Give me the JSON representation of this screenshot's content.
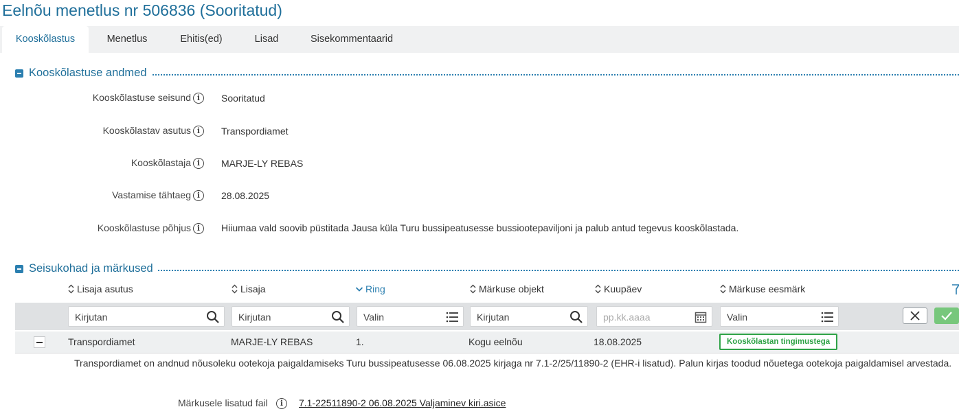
{
  "page_title": "Eelnõu menetlus nr 506836 (Sooritatud)",
  "tabs": [
    {
      "label": "Kooskõlastus",
      "active": true
    },
    {
      "label": "Menetlus",
      "active": false
    },
    {
      "label": "Ehitis(ed)",
      "active": false
    },
    {
      "label": "Lisad",
      "active": false
    },
    {
      "label": "Sisekommentaarid",
      "active": false
    }
  ],
  "section_details": {
    "title": "Kooskõlastuse andmed",
    "fields": [
      {
        "label": "Kooskõlastuse seisund",
        "value": "Sooritatud"
      },
      {
        "label": "Kooskõlastav asutus",
        "value": "Transpordiamet"
      },
      {
        "label": "Kooskõlastaja",
        "value": "MARJE-LY REBAS"
      },
      {
        "label": "Vastamise tähtaeg",
        "value": "28.08.2025"
      },
      {
        "label": "Kooskõlastuse põhjus",
        "value": "Hiiumaa vald soovib püstitada Jausa küla Turu bussipeatusesse bussiootepaviljoni ja palub antud tegevus kooskõlastada."
      }
    ]
  },
  "section_remarks": {
    "title": "Seisukohad ja märkused",
    "columns": [
      {
        "label": "Lisaja asutus",
        "sort": "none"
      },
      {
        "label": "Lisaja",
        "sort": "none"
      },
      {
        "label": "Ring",
        "sort": "desc"
      },
      {
        "label": "Märkuse objekt",
        "sort": "none"
      },
      {
        "label": "Kuupäev",
        "sort": "none"
      },
      {
        "label": "Märkuse eesmärk",
        "sort": "none"
      }
    ],
    "filters": {
      "asutus_placeholder": "Kirjutan",
      "lisaja_placeholder": "Kirjutan",
      "ring_placeholder": "Valin",
      "objekt_placeholder": "Kirjutan",
      "kuupaev_placeholder": "pp.kk.aaaa",
      "eesmark_placeholder": "Valin"
    },
    "rows": [
      {
        "asutus": "Transpordiamet",
        "lisaja": "MARJE-LY REBAS",
        "ring": "1.",
        "objekt": "Kogu eelnõu",
        "kuupaev": "18.08.2025",
        "eesmark": "Kooskõlastan tingimustega",
        "text": "Transpordiamet on andnud nõusoleku ootekoja paigaldamiseks Turu bussipeatusesse 06.08.2025 kirjaga nr 7.1-2/25/11890-2 (EHR-i lisatud). Palun kirjas toodud nõuetega ootekoja paigaldamisel arvestada.",
        "attachment_label": "Märkusele lisatud fail",
        "attachment_name": "7.1-22511890-2 06.08.2025 Valjaminev kiri.asice"
      }
    ]
  },
  "colors": {
    "accent": "#1f6f9a",
    "badge_green": "#2fa347",
    "apply_green": "#77c77c"
  }
}
